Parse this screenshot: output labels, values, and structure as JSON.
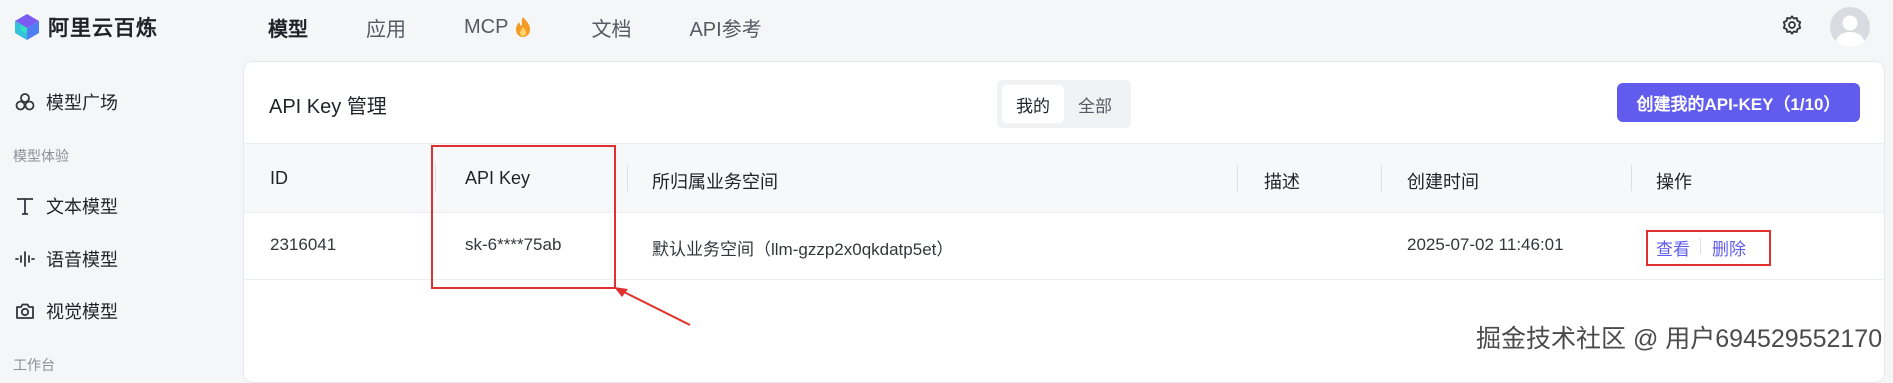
{
  "brand": {
    "name": "阿里云百炼",
    "logo_icon": "bailian-logo-icon"
  },
  "nav": {
    "items": [
      {
        "label": "模型",
        "active": true
      },
      {
        "label": "应用",
        "active": false
      },
      {
        "label": "MCP",
        "icon": "fire-icon",
        "active": false
      },
      {
        "label": "文档",
        "active": false
      },
      {
        "label": "API参考",
        "active": false
      }
    ]
  },
  "sidebar": {
    "items": [
      {
        "label": "模型广场",
        "icon": "model-plaza-icon"
      },
      {
        "label": "文本模型",
        "icon": "text-icon"
      },
      {
        "label": "语音模型",
        "icon": "audio-wave-icon"
      },
      {
        "label": "视觉模型",
        "icon": "camera-icon"
      }
    ],
    "groups": [
      "模型体验",
      "工作台"
    ]
  },
  "page": {
    "title": "API Key 管理",
    "segment": {
      "options": [
        "我的",
        "全部"
      ],
      "selected": "我的"
    },
    "create_button": "创建我的API-KEY（1/10）"
  },
  "table": {
    "columns": [
      "ID",
      "API Key",
      "所归属业务空间",
      "描述",
      "创建时间",
      "操作"
    ],
    "rows": [
      {
        "id": "2316041",
        "api_key": "sk-6****75ab",
        "workspace": "默认业务空间（llm-gzzp2x0qkdatp5et）",
        "description": "",
        "created_at": "2025-07-02 11:46:01",
        "actions": [
          "查看",
          "删除"
        ]
      }
    ]
  },
  "watermark": "掘金技术社区 @ 用户694529552170",
  "colors": {
    "accent": "#615ced",
    "annotation": "#e03131",
    "background": "#f5f6f8"
  }
}
